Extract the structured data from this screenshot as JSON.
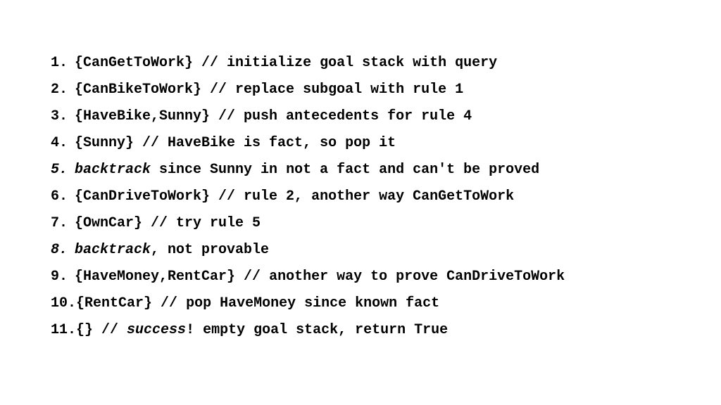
{
  "steps": [
    {
      "n": "1.",
      "goals": "{CanGetToWork}",
      "sep": " // ",
      "comment": "initialize goal stack with query"
    },
    {
      "n": "2.",
      "goals": "{CanBikeToWork}",
      "sep": " // ",
      "comment": "replace subgoal with rule 1"
    },
    {
      "n": "3.",
      "goals": "{HaveBike,Sunny}",
      "sep": " // ",
      "comment": "push antecedents for rule 4"
    },
    {
      "n": "4.",
      "goals": "{Sunny}",
      "sep": " // ",
      "comment": "HaveBike is fact, so pop it"
    },
    {
      "n": "5.",
      "italic_num": true,
      "prefix_italic": "backtrack",
      "rest": " since Sunny in not a fact and can't be proved"
    },
    {
      "n": "6.",
      "goals": "{CanDriveToWork}",
      "sep": " // ",
      "comment": "rule 2, another way CanGetToWork"
    },
    {
      "n": "7.",
      "goals": "{OwnCar}",
      "sep": " // ",
      "comment": "try rule 5"
    },
    {
      "n": "8.",
      "italic_num": true,
      "prefix_italic": "backtrack",
      "rest": ", not provable"
    },
    {
      "n": "9.",
      "goals": "{HaveMoney,RentCar}",
      "sep": " // ",
      "comment": "another way to prove CanDriveToWork"
    },
    {
      "n": "10.",
      "goals": "{RentCar}",
      "sep": " // ",
      "comment": "pop HaveMoney since known fact"
    },
    {
      "n": "11.",
      "goals": "{}",
      "sep": " // ",
      "mid_italic": "success",
      "tail": "! empty goal stack, return True"
    }
  ]
}
